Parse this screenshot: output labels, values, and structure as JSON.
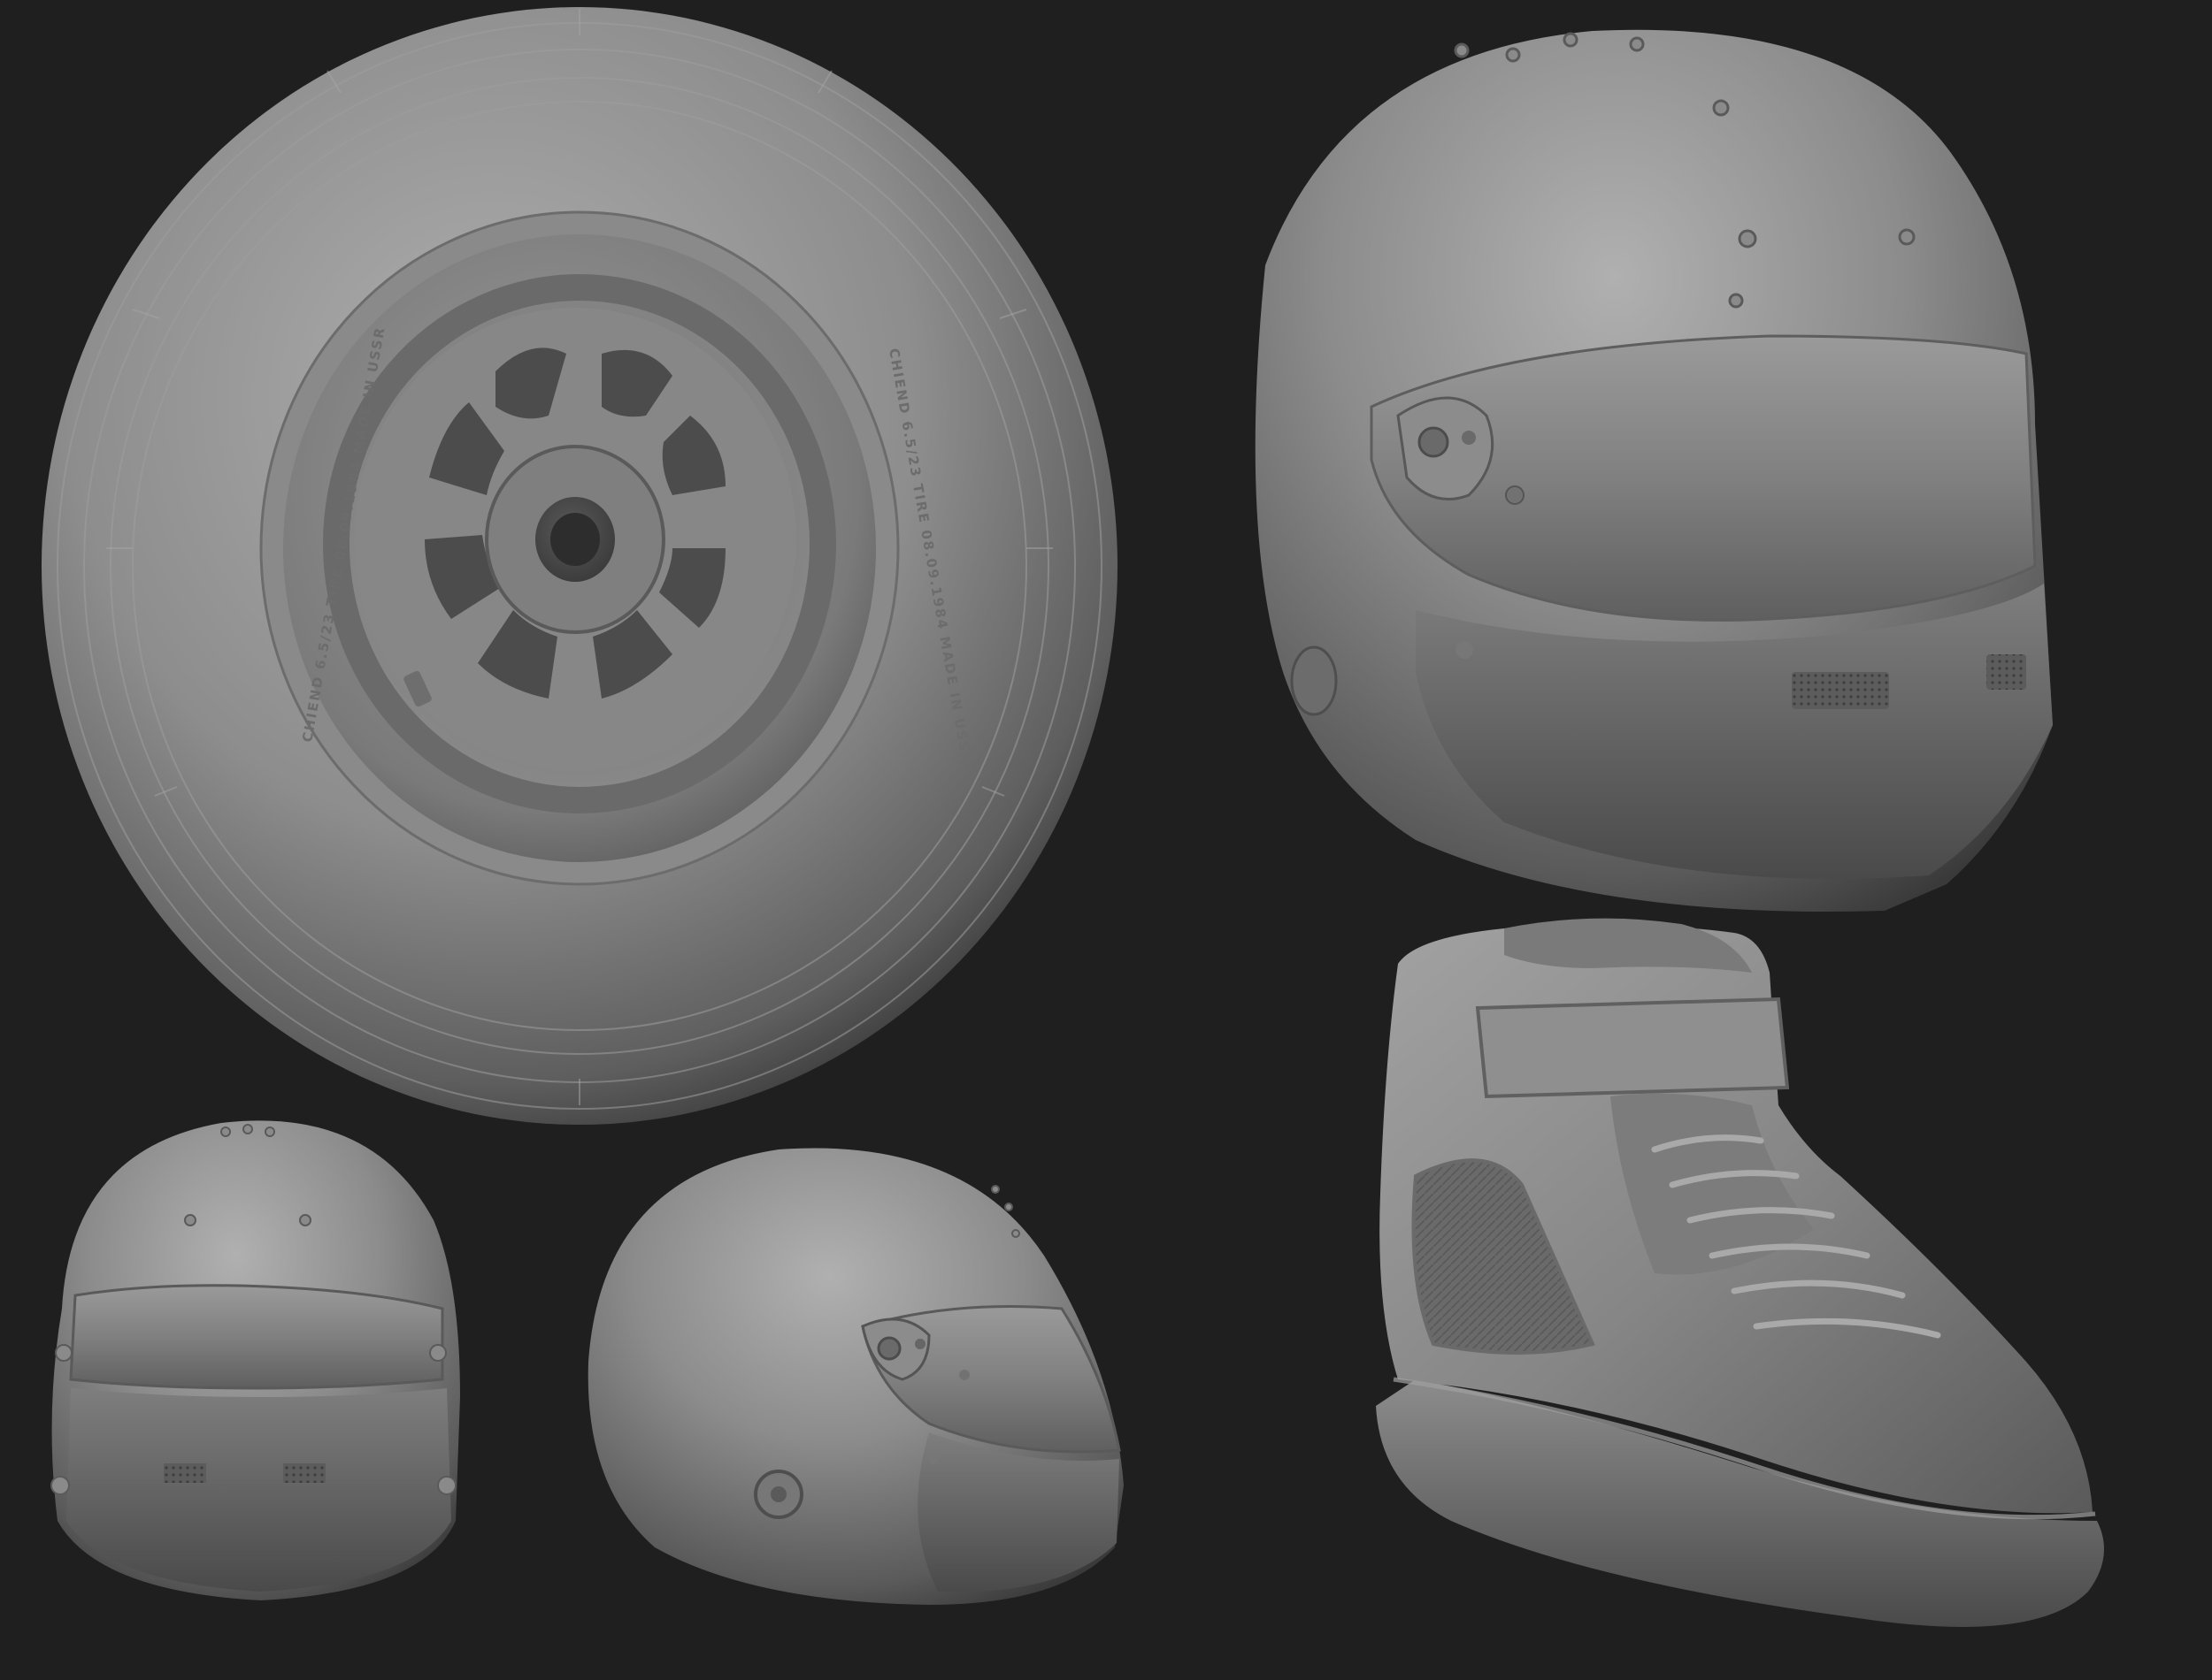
{
  "scene": {
    "background": "#1f1f20",
    "material": "#8a8a8a",
    "objects": [
      "racing-tire",
      "racing-helmet-three-quarter",
      "racing-helmet-front",
      "racing-helmet-side",
      "racing-boot"
    ]
  },
  "tire": {
    "sidewall_left": "CHIEND 6.5/23 TIRE 08.09.1984 MADE IN USSR",
    "sidewall_right": "CHIEND 6.5/23 TIRE 08.09.1984 MADE IN USSR"
  }
}
